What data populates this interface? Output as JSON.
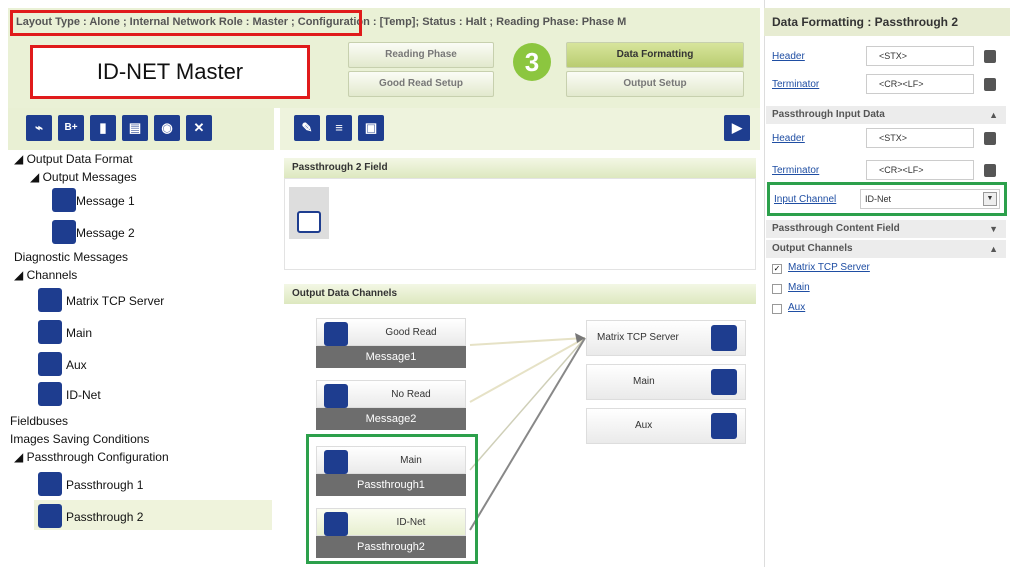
{
  "header": {
    "status_line": "Layout Type : Alone ; Internal Network Role : Master ; Configuration : [Temp]; Status : Halt ; Reading Phase: Phase M",
    "device_label": "ID-NET Master",
    "step_number": "3",
    "phase_buttons": [
      "Reading Phase",
      "Data Formatting",
      "Good Read Setup",
      "Output Setup"
    ]
  },
  "tree": {
    "items": [
      {
        "label": "◢ Output Data Format"
      },
      {
        "label": "◢ Output Messages"
      },
      {
        "label": "Message 1"
      },
      {
        "label": "Message 2"
      },
      {
        "label": "Diagnostic Messages"
      },
      {
        "label": "◢ Channels"
      },
      {
        "label": "Matrix TCP Server"
      },
      {
        "label": "Main"
      },
      {
        "label": "Aux"
      },
      {
        "label": "ID-Net"
      },
      {
        "label": "Fieldbuses"
      },
      {
        "label": "Images Saving Conditions"
      },
      {
        "label": "◢ Passthrough Configuration"
      },
      {
        "label": "Passthrough 1"
      },
      {
        "label": "Passthrough 2"
      }
    ]
  },
  "middle": {
    "field_section": "Passthrough 2 Field",
    "channels_section": "Output Data Channels",
    "inputs": [
      {
        "label": "Good Read",
        "sub": "Message1"
      },
      {
        "label": "No Read",
        "sub": "Message2"
      },
      {
        "label": "Main",
        "sub": "Passthrough1"
      },
      {
        "label": "ID-Net",
        "sub": "Passthrough2"
      }
    ],
    "outputs": [
      "Matrix TCP Server",
      "Main",
      "Aux"
    ]
  },
  "right": {
    "title": "Data Formatting : Passthrough 2",
    "header_label": "Header",
    "header_value": "<STX>",
    "terminator_label": "Terminator",
    "terminator_value": "<CR><LF>",
    "input_section": "Passthrough Input Data",
    "input_header_label": "Header",
    "input_header_value": "<STX>",
    "input_terminator_label": "Terminator",
    "input_terminator_value": "<CR><LF>",
    "input_channel_label": "Input Channel",
    "input_channel_value": "ID-Net",
    "content_section": "Passthrough Content Field",
    "output_section": "Output Channels",
    "output_channels": [
      {
        "label": "Matrix TCP Server",
        "checked": true
      },
      {
        "label": "Main",
        "checked": false
      },
      {
        "label": "Aux",
        "checked": false
      }
    ]
  },
  "colors": {
    "accent_red": "#e01b1b",
    "accent_green": "#2ca04b",
    "icon_blue": "#1e3d8f"
  }
}
